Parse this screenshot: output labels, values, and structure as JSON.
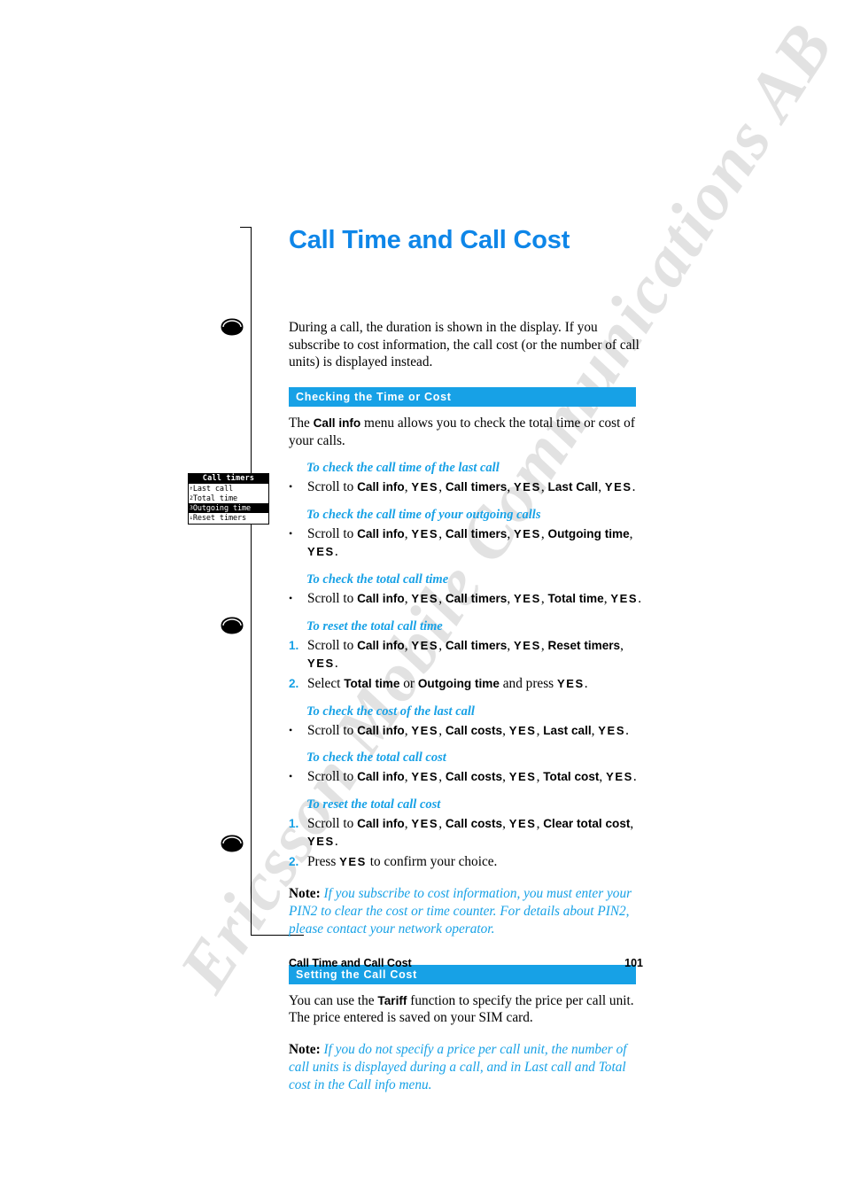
{
  "watermark": {
    "text": "Ericsson Mobile Communications AB"
  },
  "page": {
    "title": "Call Time and Call Cost",
    "intro": "During a call, the duration is shown in the display. If you subscribe to cost information, the call cost (or the number of call units) is displayed instead."
  },
  "phone_display": {
    "title": "Call timers",
    "rows": [
      {
        "num": "1",
        "label": "Last call",
        "selected": false
      },
      {
        "num": "2",
        "label": "Total time",
        "selected": false
      },
      {
        "num": "3",
        "label": "Outgoing time",
        "selected": true
      },
      {
        "num": "4",
        "label": "Reset timers",
        "selected": false
      }
    ],
    "scroll_up": "↑",
    "scroll_down": "↓"
  },
  "sections": [
    {
      "bar": "Checking the Time or Cost",
      "lead_before": "The ",
      "lead_bold": "Call info",
      "lead_after": " menu allows you to check the total time or cost of your calls.",
      "groups": [
        {
          "heading": "To check the call time of the last call",
          "steps": [
            {
              "marker": "•",
              "marker_style": "bullet",
              "parts": [
                {
                  "t": "Scroll to ",
                  "s": "plain"
                },
                {
                  "t": "Call info",
                  "s": "ui"
                },
                {
                  "t": ", ",
                  "s": "plain"
                },
                {
                  "t": "YES",
                  "s": "key"
                },
                {
                  "t": ", ",
                  "s": "plain"
                },
                {
                  "t": "Call timers",
                  "s": "ui"
                },
                {
                  "t": ", ",
                  "s": "plain"
                },
                {
                  "t": "YES",
                  "s": "key"
                },
                {
                  "t": ", ",
                  "s": "plain"
                },
                {
                  "t": "Last Call",
                  "s": "ui"
                },
                {
                  "t": ", ",
                  "s": "plain"
                },
                {
                  "t": "YES",
                  "s": "key"
                },
                {
                  "t": ".",
                  "s": "plain"
                }
              ]
            }
          ]
        },
        {
          "heading": "To check the call time of your outgoing calls",
          "steps": [
            {
              "marker": "•",
              "marker_style": "bullet",
              "parts": [
                {
                  "t": "Scroll to ",
                  "s": "plain"
                },
                {
                  "t": "Call info",
                  "s": "ui"
                },
                {
                  "t": ", ",
                  "s": "plain"
                },
                {
                  "t": "YES",
                  "s": "key"
                },
                {
                  "t": ", ",
                  "s": "plain"
                },
                {
                  "t": "Call timers",
                  "s": "ui"
                },
                {
                  "t": ", ",
                  "s": "plain"
                },
                {
                  "t": "YES",
                  "s": "key"
                },
                {
                  "t": ", ",
                  "s": "plain"
                },
                {
                  "t": "Outgoing time",
                  "s": "ui"
                },
                {
                  "t": ", ",
                  "s": "plain"
                },
                {
                  "t": "YES",
                  "s": "key"
                },
                {
                  "t": ".",
                  "s": "plain"
                }
              ]
            }
          ]
        },
        {
          "heading": "To check the total call time",
          "steps": [
            {
              "marker": "•",
              "marker_style": "bullet",
              "parts": [
                {
                  "t": "Scroll to ",
                  "s": "plain"
                },
                {
                  "t": "Call info",
                  "s": "ui"
                },
                {
                  "t": ", ",
                  "s": "plain"
                },
                {
                  "t": "YES",
                  "s": "key"
                },
                {
                  "t": ", ",
                  "s": "plain"
                },
                {
                  "t": "Call timers",
                  "s": "ui"
                },
                {
                  "t": ", ",
                  "s": "plain"
                },
                {
                  "t": "YES",
                  "s": "key"
                },
                {
                  "t": ", ",
                  "s": "plain"
                },
                {
                  "t": "Total time",
                  "s": "ui"
                },
                {
                  "t": ", ",
                  "s": "plain"
                },
                {
                  "t": "YES",
                  "s": "key"
                },
                {
                  "t": ".",
                  "s": "plain"
                }
              ]
            }
          ]
        },
        {
          "heading": "To reset the total call time",
          "steps": [
            {
              "marker": "1.",
              "marker_style": "num",
              "parts": [
                {
                  "t": "Scroll to ",
                  "s": "plain"
                },
                {
                  "t": "Call info",
                  "s": "ui"
                },
                {
                  "t": ", ",
                  "s": "plain"
                },
                {
                  "t": "YES",
                  "s": "key"
                },
                {
                  "t": ", ",
                  "s": "plain"
                },
                {
                  "t": "Call timers",
                  "s": "ui"
                },
                {
                  "t": ", ",
                  "s": "plain"
                },
                {
                  "t": "YES",
                  "s": "key"
                },
                {
                  "t": ", ",
                  "s": "plain"
                },
                {
                  "t": "Reset timers",
                  "s": "ui"
                },
                {
                  "t": ", ",
                  "s": "plain"
                },
                {
                  "t": "YES",
                  "s": "key"
                },
                {
                  "t": ".",
                  "s": "plain"
                }
              ]
            },
            {
              "marker": "2.",
              "marker_style": "num",
              "parts": [
                {
                  "t": "Select ",
                  "s": "plain"
                },
                {
                  "t": "Total time",
                  "s": "ui"
                },
                {
                  "t": " or ",
                  "s": "plain"
                },
                {
                  "t": "Outgoing time",
                  "s": "ui"
                },
                {
                  "t": " and press ",
                  "s": "plain"
                },
                {
                  "t": "YES",
                  "s": "key"
                },
                {
                  "t": ".",
                  "s": "plain"
                }
              ]
            }
          ]
        },
        {
          "heading": "To check the cost of the last call",
          "steps": [
            {
              "marker": "•",
              "marker_style": "bullet",
              "parts": [
                {
                  "t": "Scroll to ",
                  "s": "plain"
                },
                {
                  "t": "Call info",
                  "s": "ui"
                },
                {
                  "t": ", ",
                  "s": "plain"
                },
                {
                  "t": "YES",
                  "s": "key"
                },
                {
                  "t": ", ",
                  "s": "plain"
                },
                {
                  "t": "Call costs",
                  "s": "ui"
                },
                {
                  "t": ", ",
                  "s": "plain"
                },
                {
                  "t": "YES",
                  "s": "key"
                },
                {
                  "t": ", ",
                  "s": "plain"
                },
                {
                  "t": "Last call",
                  "s": "ui"
                },
                {
                  "t": ", ",
                  "s": "plain"
                },
                {
                  "t": "YES",
                  "s": "key"
                },
                {
                  "t": ".",
                  "s": "plain"
                }
              ]
            }
          ]
        },
        {
          "heading": "To check the total call cost",
          "steps": [
            {
              "marker": "•",
              "marker_style": "bullet",
              "parts": [
                {
                  "t": "Scroll to ",
                  "s": "plain"
                },
                {
                  "t": "Call info",
                  "s": "ui"
                },
                {
                  "t": ", ",
                  "s": "plain"
                },
                {
                  "t": "YES",
                  "s": "key"
                },
                {
                  "t": ", ",
                  "s": "plain"
                },
                {
                  "t": "Call costs",
                  "s": "ui"
                },
                {
                  "t": ", ",
                  "s": "plain"
                },
                {
                  "t": "YES",
                  "s": "key"
                },
                {
                  "t": ", ",
                  "s": "plain"
                },
                {
                  "t": "Total cost",
                  "s": "ui"
                },
                {
                  "t": ", ",
                  "s": "plain"
                },
                {
                  "t": "YES",
                  "s": "key"
                },
                {
                  "t": ".",
                  "s": "plain"
                }
              ]
            }
          ]
        },
        {
          "heading": "To reset the total call cost",
          "steps": [
            {
              "marker": "1.",
              "marker_style": "num",
              "parts": [
                {
                  "t": "Scroll to ",
                  "s": "plain"
                },
                {
                  "t": "Call info",
                  "s": "ui"
                },
                {
                  "t": ", ",
                  "s": "plain"
                },
                {
                  "t": "YES",
                  "s": "key"
                },
                {
                  "t": ", ",
                  "s": "plain"
                },
                {
                  "t": "Call costs",
                  "s": "ui"
                },
                {
                  "t": ", ",
                  "s": "plain"
                },
                {
                  "t": "YES",
                  "s": "key"
                },
                {
                  "t": ", ",
                  "s": "plain"
                },
                {
                  "t": "Clear total cost",
                  "s": "ui"
                },
                {
                  "t": ", ",
                  "s": "plain"
                },
                {
                  "t": "YES",
                  "s": "key"
                },
                {
                  "t": ".",
                  "s": "plain"
                }
              ]
            },
            {
              "marker": "2.",
              "marker_style": "num",
              "parts": [
                {
                  "t": "Press ",
                  "s": "plain"
                },
                {
                  "t": "YES",
                  "s": "key"
                },
                {
                  "t": " to confirm your choice.",
                  "s": "plain"
                }
              ]
            }
          ]
        }
      ],
      "note": {
        "label": "Note:",
        "text": "If you subscribe to cost information, you must enter your PIN2 to clear the cost or time counter. For details about PIN2, please contact your network operator."
      }
    },
    {
      "bar": "Setting the Call Cost",
      "lead_before": "You can use the ",
      "lead_bold": "Tariff",
      "lead_after": " function to specify the price per call unit. The price entered is saved on your SIM card.",
      "groups": [],
      "note": {
        "label": "Note:",
        "text": "If you do not specify a price per call unit, the number of call units is displayed during a call, and in Last call and Total cost in the Call info menu."
      }
    }
  ],
  "footer": {
    "chapter": "Call Time and Call Cost",
    "page_number": "101"
  },
  "colors": {
    "accent_blue": "#17a1e6",
    "title_blue": "#0e86e8",
    "watermark_gray": "#e2e2e2"
  }
}
